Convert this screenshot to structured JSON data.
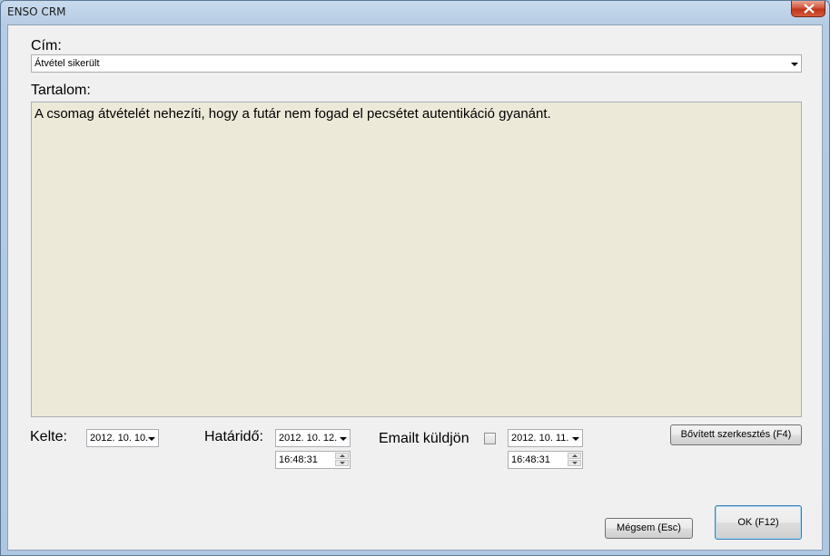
{
  "window": {
    "title": "ENSO CRM"
  },
  "form": {
    "cim_label": "Cím:",
    "cim_value": "Átvétel sikerült",
    "tartalom_label": "Tartalom:",
    "tartalom_value": "A csomag átvételét nehezíti, hogy a futár nem fogad el pecsétet autentikáció gyanánt.",
    "kelte_label": "Kelte:",
    "kelte_date": "2012. 10. 10.",
    "hatarido_label": "Határidő:",
    "hatarido_date": "2012. 10. 12.",
    "hatarido_time": "16:48:31",
    "email_label": "Emailt küldjön",
    "email_checked": false,
    "email_date": "2012. 10. 11.",
    "email_time": "16:48:31"
  },
  "buttons": {
    "extended_edit": "Bővített szerkesztés (F4)",
    "cancel": "Mégsem (Esc)",
    "ok": "OK (F12)"
  }
}
